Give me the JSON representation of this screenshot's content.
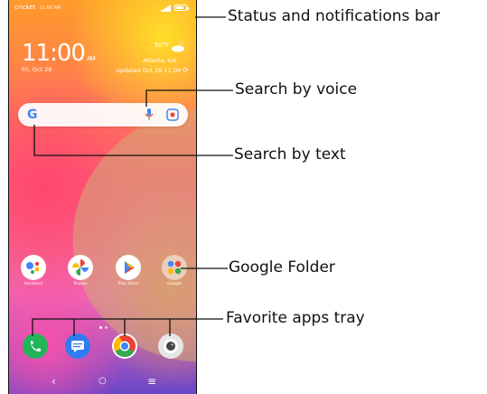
{
  "status_bar": {
    "carrier": "cricket",
    "time": "11:00 AM"
  },
  "clock": {
    "time": "11:00",
    "ampm": "AM",
    "date": "Fri, Oct 28"
  },
  "weather": {
    "temp": "50°F",
    "city": "Atlanta, GA",
    "updated": "Updated Oct 28 11:00"
  },
  "search": {
    "g_letter": "G"
  },
  "apps": [
    {
      "label": "Assistant"
    },
    {
      "label": "Photos"
    },
    {
      "label": "Play Store"
    },
    {
      "label": "Google"
    }
  ],
  "favorites": [
    {
      "name": "Phone"
    },
    {
      "name": "Messages"
    },
    {
      "name": "Chrome"
    },
    {
      "name": "Camera"
    }
  ],
  "navbar": {
    "back": "‹",
    "home": "○",
    "recents": "≡"
  },
  "callouts": {
    "status": "Status and notifications bar",
    "voice": "Search by voice",
    "text": "Search by text",
    "folder": "Google Folder",
    "tray": "Favorite apps tray"
  },
  "colors": {
    "google_blue": "#4285F4",
    "google_red": "#EA4335",
    "google_yellow": "#FBBC05",
    "google_green": "#34A853"
  }
}
